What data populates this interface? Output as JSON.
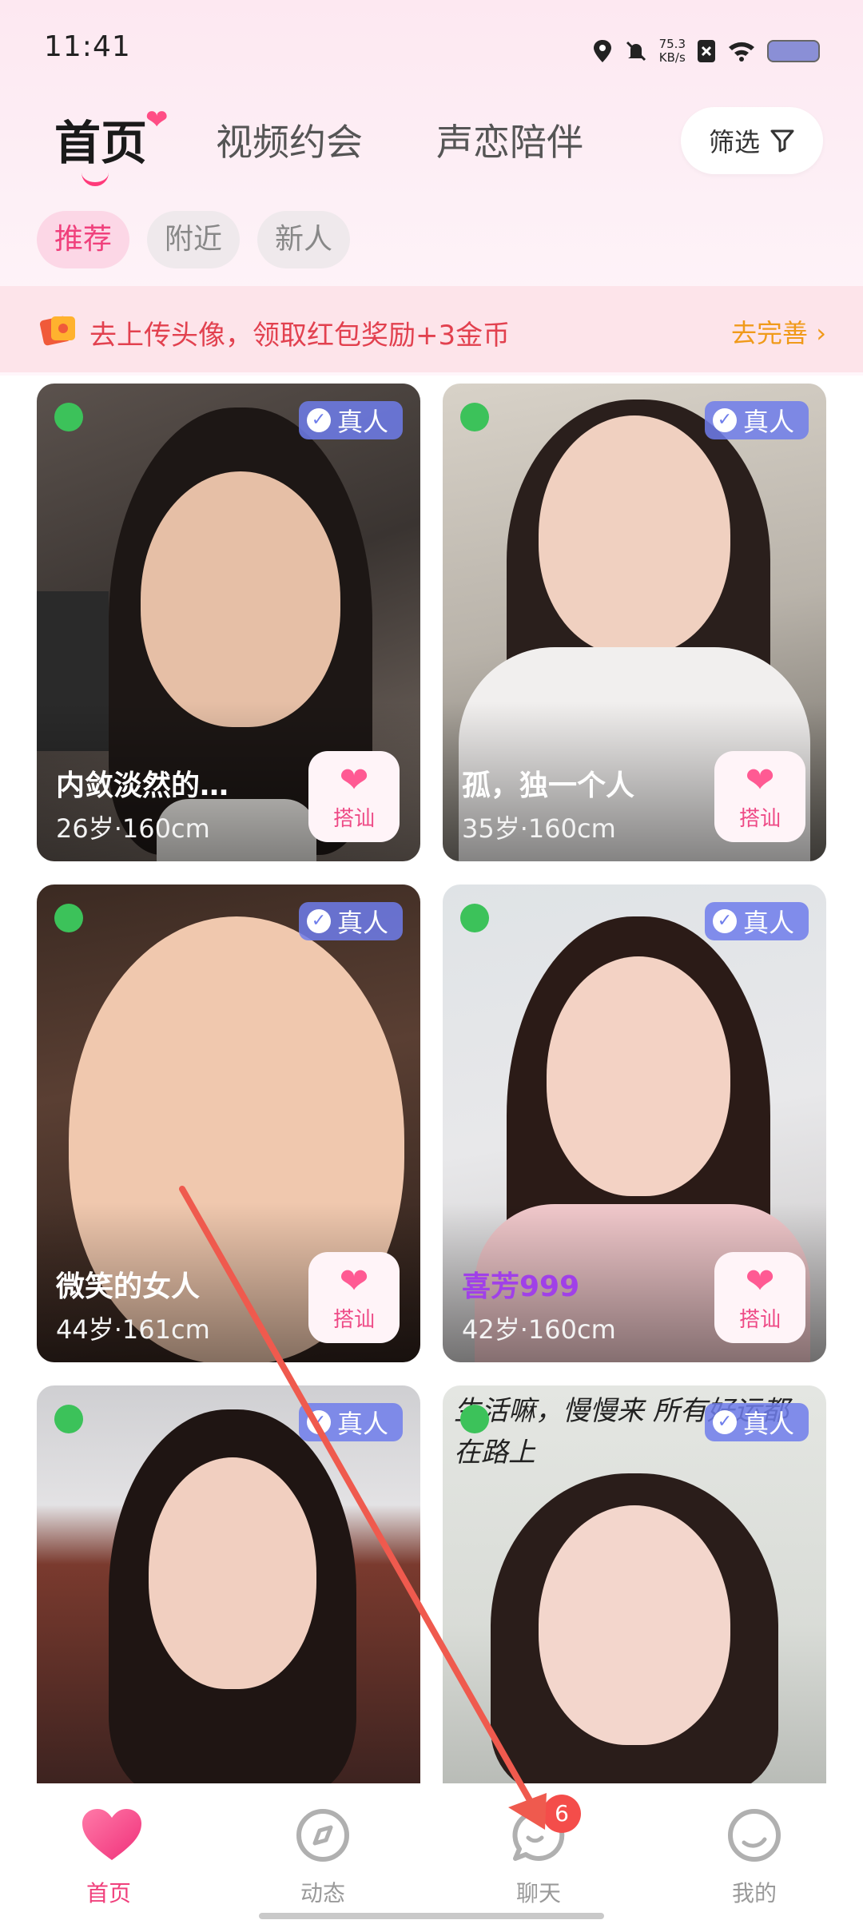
{
  "status_bar": {
    "time": "11:41",
    "net_speed_value": "75.3",
    "net_speed_unit": "KB/s"
  },
  "header": {
    "tabs": [
      {
        "label": "首页",
        "active": true
      },
      {
        "label": "视频约会",
        "active": false
      },
      {
        "label": "声恋陪伴",
        "active": false
      }
    ],
    "filter_label": "筛选"
  },
  "sub_tabs": [
    {
      "label": "推荐",
      "active": true
    },
    {
      "label": "附近",
      "active": false
    },
    {
      "label": "新人",
      "active": false
    }
  ],
  "banner": {
    "text": "去上传头像，领取红包奖励+3金币",
    "link": "去完善 ›"
  },
  "cards": [
    {
      "name": "内敛淡然的…",
      "meta": "26岁·160cm",
      "verified_label": "真人",
      "greet_label": "搭讪",
      "online": true
    },
    {
      "name": "孤，独一个人",
      "meta": "35岁·160cm",
      "verified_label": "真人",
      "greet_label": "搭讪",
      "online": true
    },
    {
      "name": "微笑的女人",
      "meta": "44岁·161cm",
      "verified_label": "真人",
      "greet_label": "搭讪",
      "online": true
    },
    {
      "name": "喜芳999",
      "meta": "42岁·160cm",
      "verified_label": "真人",
      "greet_label": "搭讪",
      "online": true,
      "name_color": "#a040e8"
    },
    {
      "name": "",
      "meta": "",
      "verified_label": "真人",
      "greet_label": "",
      "online": true
    },
    {
      "name": "",
      "meta": "",
      "verified_label": "真人",
      "greet_label": "",
      "online": true,
      "photo_text": "生活嘛，慢慢来 所有好运都在路上"
    }
  ],
  "bottom_nav": [
    {
      "label": "首页",
      "icon": "heart-icon",
      "active": true
    },
    {
      "label": "动态",
      "icon": "compass-icon",
      "active": false
    },
    {
      "label": "聊天",
      "icon": "chat-icon",
      "active": false,
      "badge": "6"
    },
    {
      "label": "我的",
      "icon": "profile-icon",
      "active": false
    }
  ],
  "colors": {
    "accent": "#f0407c",
    "banner_text": "#e2414f",
    "banner_link": "#f09a1a",
    "verify_bg": "#6e7deb",
    "online": "#3cc25a"
  }
}
